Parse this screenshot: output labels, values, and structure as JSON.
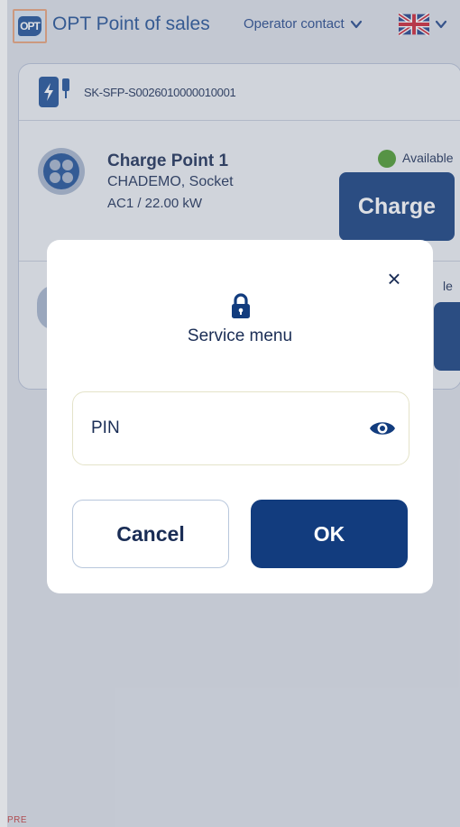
{
  "header": {
    "logo_text": "OPT",
    "app_title": "OPT Point of sales",
    "operator_contact": "Operator contact",
    "language_icon": "uk-flag-icon"
  },
  "station": {
    "serial": "SK-SFP-S0026010000010001",
    "connectors": [
      {
        "name": "Charge Point 1",
        "type": "CHADEMO, Socket",
        "power": "AC1 / 22.00 kW",
        "status": "Available",
        "status_color": "#4b9a2d",
        "action": "Charge"
      },
      {
        "status": "le"
      }
    ]
  },
  "modal": {
    "close_icon": "close-icon",
    "lock_icon": "lock-icon",
    "title": "Service menu",
    "pin_placeholder": "PIN",
    "pin_value": "",
    "cancel_label": "Cancel",
    "ok_label": "OK"
  },
  "footer": {
    "text": "PRE"
  },
  "colors": {
    "primary": "#123c7e",
    "brand_text": "#1f4e93",
    "text": "#1a2d55",
    "available": "#4b9a2d"
  }
}
